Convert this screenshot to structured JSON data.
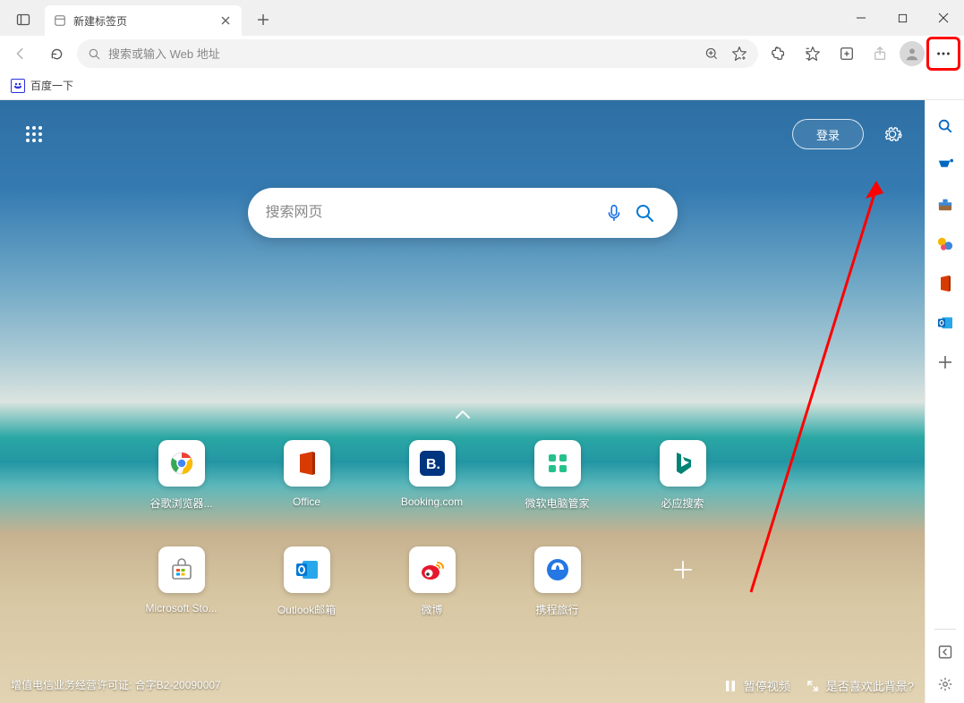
{
  "titlebar": {
    "tab_title": "新建标签页",
    "new_tab_tooltip": "+"
  },
  "toolbar": {
    "address_placeholder": "搜索或输入 Web 地址"
  },
  "favbar": {
    "item1_label": "百度一下"
  },
  "ntp": {
    "login_label": "登录",
    "search_placeholder": "搜索网页",
    "tiles_row1": [
      {
        "label": "谷歌浏览器...",
        "icon": "chrome"
      },
      {
        "label": "Office",
        "icon": "office"
      },
      {
        "label": "Booking.com",
        "icon": "booking"
      },
      {
        "label": "微软电脑管家",
        "icon": "pcmanager"
      },
      {
        "label": "必应搜索",
        "icon": "bing"
      }
    ],
    "tiles_row2": [
      {
        "label": "Microsoft Sto...",
        "icon": "msstore"
      },
      {
        "label": "Outlook邮箱",
        "icon": "outlook"
      },
      {
        "label": "微博",
        "icon": "weibo"
      },
      {
        "label": "携程旅行",
        "icon": "ctrip"
      }
    ],
    "footer_license": "增值电信业务经营许可证: 合字B2-20090007",
    "footer_pause_label": "暂停视频",
    "footer_like_label": "是否喜欢此背景?"
  },
  "icons": {
    "chrome_color": "#ea4335",
    "office_color": "#d83b01",
    "booking_color": "#003580",
    "pcmanager_color": "#24c18a",
    "bing_color": "#008373",
    "msstore_color": "#6b6b6b",
    "outlook_color": "#0078d4",
    "weibo_color": "#e6162d",
    "ctrip_color": "#2577e3"
  }
}
